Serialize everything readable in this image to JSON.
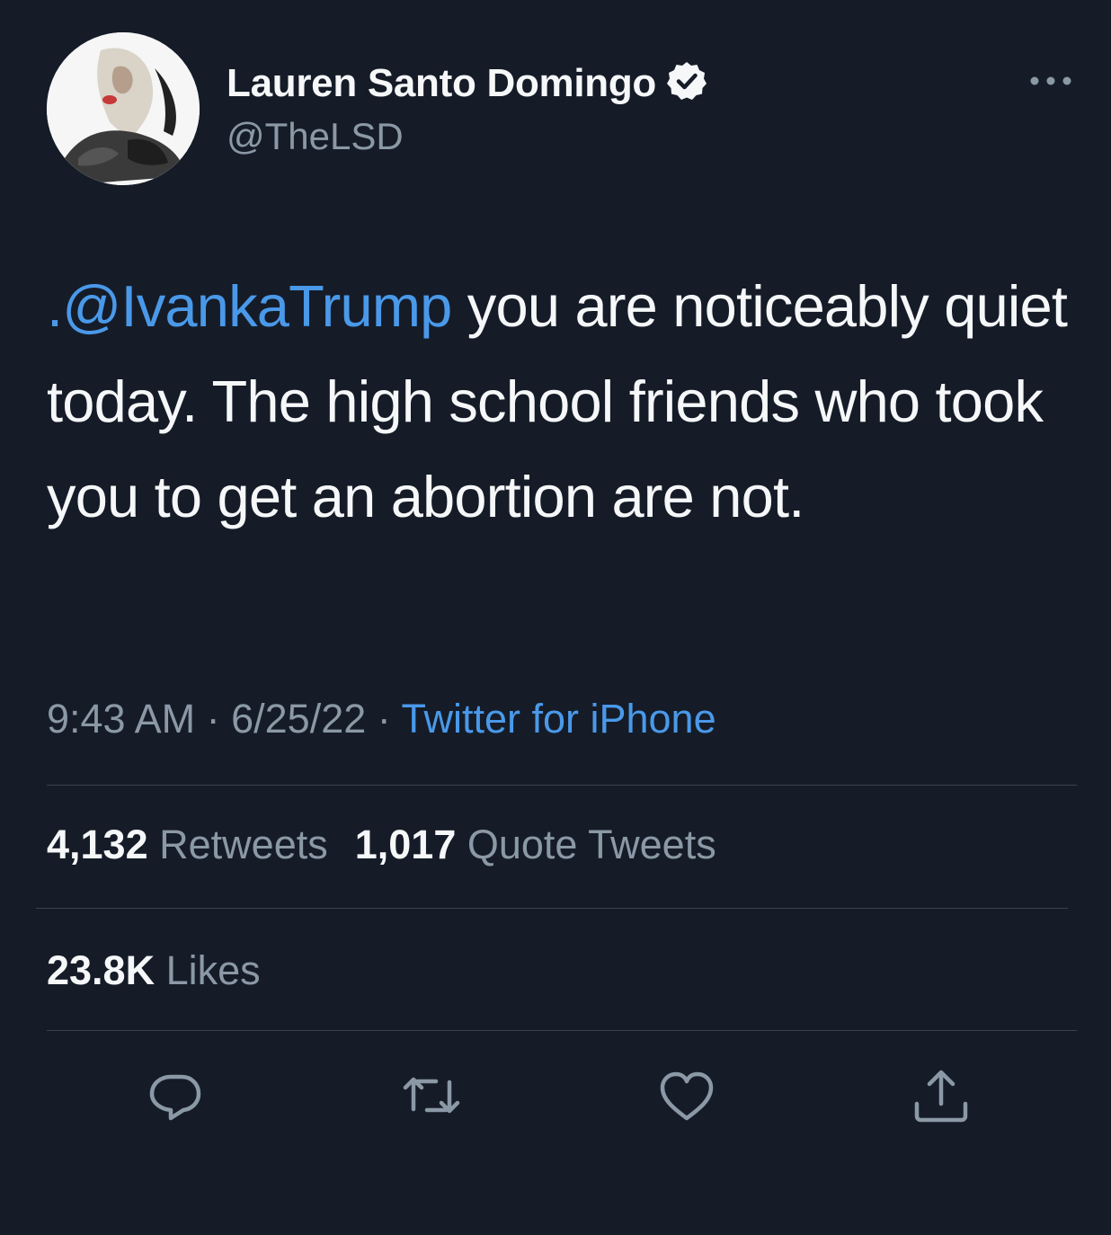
{
  "author": {
    "display_name": "Lauren Santo Domingo",
    "handle": "@TheLSD",
    "verified": true
  },
  "tweet": {
    "mention": ".@IvankaTrump",
    "text": " you are noticeably quiet today. The high school friends who took you to get an abortion are not."
  },
  "meta": {
    "time": "9:43 AM",
    "separator_1": " · ",
    "date": "6/25/22",
    "separator_2": " · ",
    "source": "Twitter for iPhone"
  },
  "stats": {
    "retweets_count": "4,132",
    "retweets_label": "Retweets",
    "quote_count": "1,017",
    "quote_label": "Quote Tweets",
    "likes_count": "23.8K",
    "likes_label": "Likes"
  },
  "icons": {
    "more": "more-dots-icon",
    "verified": "verified-badge-icon",
    "reply": "reply-icon",
    "retweet": "retweet-icon",
    "like": "heart-icon",
    "share": "share-icon"
  },
  "colors": {
    "background": "#151c28",
    "accent": "#4a99e9",
    "secondary_text": "#8b98a5",
    "divider": "#38424f"
  }
}
